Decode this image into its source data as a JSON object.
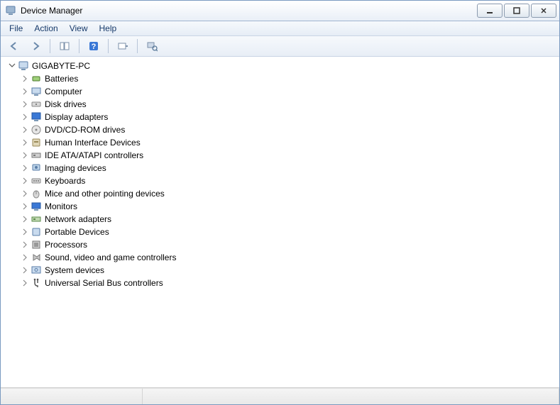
{
  "title": "Device Manager",
  "menu": {
    "file": "File",
    "action": "Action",
    "view": "View",
    "help": "Help"
  },
  "tree": {
    "root": "GIGABYTE-PC",
    "items": [
      "Batteries",
      "Computer",
      "Disk drives",
      "Display adapters",
      "DVD/CD-ROM drives",
      "Human Interface Devices",
      "IDE ATA/ATAPI controllers",
      "Imaging devices",
      "Keyboards",
      "Mice and other pointing devices",
      "Monitors",
      "Network adapters",
      "Portable Devices",
      "Processors",
      "Sound, video and game controllers",
      "System devices",
      "Universal Serial Bus controllers"
    ]
  }
}
